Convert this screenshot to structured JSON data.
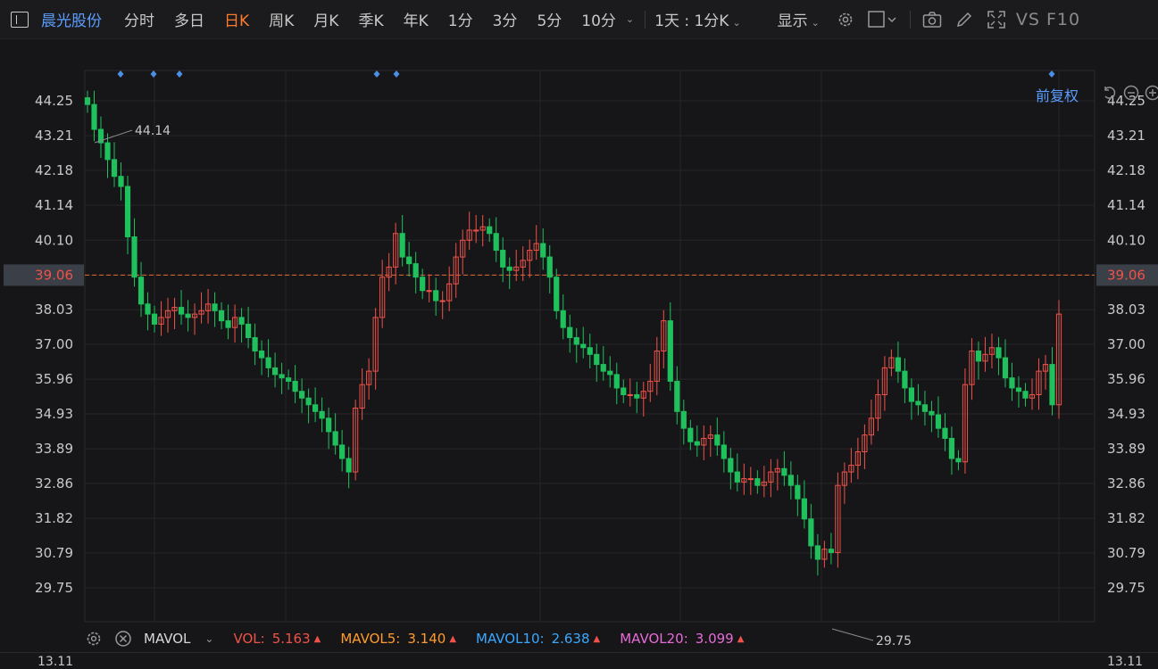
{
  "toolbar": {
    "stock_name": "晨光股份",
    "periods": [
      {
        "label": "分时",
        "active": false
      },
      {
        "label": "多日",
        "active": false
      },
      {
        "label": "日K",
        "active": true
      },
      {
        "label": "周K",
        "active": false
      },
      {
        "label": "月K",
        "active": false
      },
      {
        "label": "季K",
        "active": false
      },
      {
        "label": "年K",
        "active": false
      },
      {
        "label": "1分",
        "active": false
      },
      {
        "label": "3分",
        "active": false
      },
      {
        "label": "5分",
        "active": false
      },
      {
        "label": "10分",
        "active": false
      }
    ],
    "interval_select": "1天 : 1分K",
    "display_label": "显示",
    "vs_label": "VS F10"
  },
  "chart": {
    "adjust_label": "前复权",
    "y_ticks": [
      "44.25",
      "43.21",
      "42.18",
      "41.14",
      "40.10",
      "39.06",
      "38.03",
      "37.00",
      "35.96",
      "34.93",
      "33.89",
      "32.86",
      "31.82",
      "30.79",
      "29.75"
    ],
    "y_min": 29.75,
    "y_max": 44.25,
    "current_price": "39.06",
    "high_label": "44.14",
    "low_label": "29.75",
    "colors": {
      "up": "#f0524a",
      "down": "#1fc15d",
      "price_line": "#e66a2c",
      "grid": "#262628",
      "marker": "#4a90e2"
    }
  },
  "indicators": {
    "name": "MAVOL",
    "items": [
      {
        "label": "VOL:",
        "value": "5.163",
        "color": "#f0524a"
      },
      {
        "label": "MAVOL5:",
        "value": "3.140",
        "color": "#ff9b2c"
      },
      {
        "label": "MAVOL10:",
        "value": "2.638",
        "color": "#3aa8ff"
      },
      {
        "label": "MAVOL20:",
        "value": "3.099",
        "color": "#e76bd6"
      }
    ],
    "trend_up_color": "#f0524a"
  },
  "volume_panel": {
    "top_tick": "13.11"
  }
}
